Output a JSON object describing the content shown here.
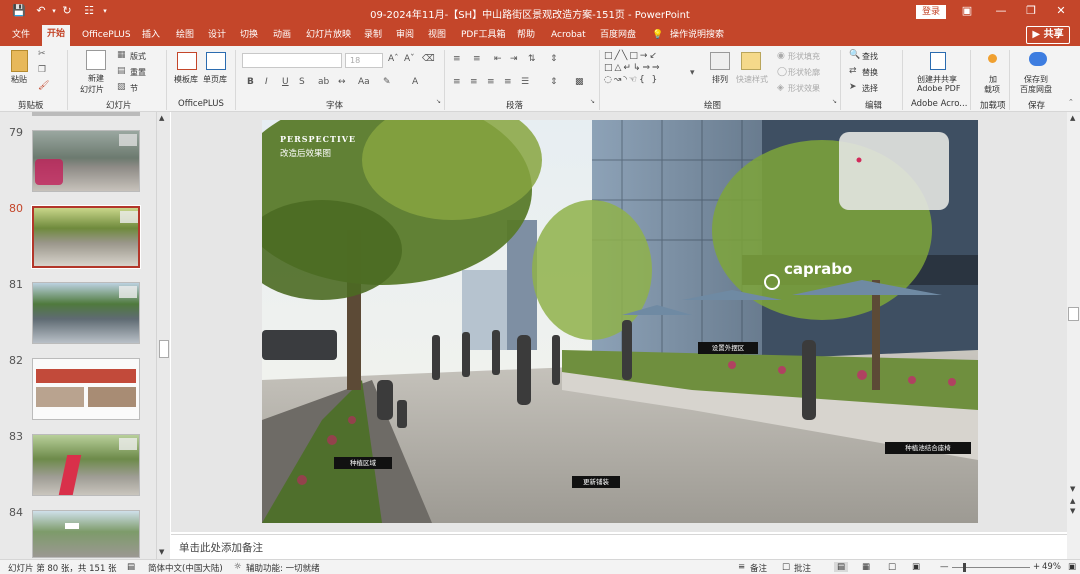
{
  "title_bar": {
    "title": "09-2024年11月-【SH】中山路街区景观改造方案-151页  -  PowerPoint",
    "login": "登录",
    "icons": [
      "save-icon",
      "undo-icon",
      "redo-icon",
      "customize-icon",
      "minimize-icon",
      "restore-icon",
      "close-icon",
      "ribbon-display-icon"
    ]
  },
  "tabs": [
    "文件",
    "开始",
    "OfficePLUS",
    "插入",
    "绘图",
    "设计",
    "切换",
    "动画",
    "幻灯片放映",
    "录制",
    "审阅",
    "视图",
    "PDF工具箱",
    "帮助",
    "Acrobat",
    "百度网盘"
  ],
  "active_tab": "开始",
  "tell_me": "操作说明搜索",
  "share": "共享",
  "ribbon": {
    "clipboard": {
      "paste": "粘贴",
      "label": "剪贴板"
    },
    "slides": {
      "new_slide": "新建",
      "new_slide2": "幻灯片",
      "layout": "版式",
      "reset": "重置",
      "section": "节",
      "label": "幻灯片"
    },
    "officeplus": {
      "template": "模板库",
      "single": "单页库",
      "label": "OfficePLUS"
    },
    "font": {
      "size": "18",
      "bold": "B",
      "italic": "I",
      "underline": "U",
      "strike": "S",
      "label": "字体"
    },
    "paragraph": {
      "label": "段落"
    },
    "drawing": {
      "arrange": "排列",
      "quick_styles": "快速样式",
      "fill": "形状填充",
      "outline": "形状轮廓",
      "effect": "形状效果",
      "label": "绘图"
    },
    "editing": {
      "find": "查找",
      "replace": "替换",
      "select": "选择",
      "label": "编辑"
    },
    "adobe": {
      "create1": "创建并共享",
      "create2": "Adobe PDF",
      "label": "Adobe Acro..."
    },
    "addins": {
      "add1": "加",
      "add2": "载项",
      "label": "加载项"
    },
    "save": {
      "save1": "保存到",
      "save2": "百度网盘",
      "label": "保存"
    }
  },
  "thumbnails": [
    {
      "num": "79"
    },
    {
      "num": "80",
      "selected": true
    },
    {
      "num": "81"
    },
    {
      "num": "82"
    },
    {
      "num": "83"
    },
    {
      "num": "84"
    }
  ],
  "slide": {
    "heading1": "PERSPECTIVE",
    "heading2": "改造后效果图",
    "brand": "caprabo",
    "callouts": [
      "设置外摆区",
      "种植区域",
      "更新铺装",
      "种植池结合座椅"
    ]
  },
  "notes_placeholder": "单击此处添加备注",
  "status": {
    "slide_info": "幻灯片 第 80 张，共 151 张",
    "language": "简体中文(中国大陆)",
    "accessibility": "辅助功能: 一切就绪",
    "notes": "备注",
    "comments": "批注",
    "zoom": "49%"
  },
  "colors": {
    "accent": "#c4462a",
    "ribbon_bg": "#f3f3f3"
  }
}
